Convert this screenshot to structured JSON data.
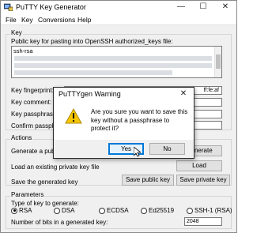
{
  "window": {
    "title": "PuTTY Key Generator",
    "controls": {
      "minimize": "—",
      "maximize": "☐",
      "close": "✕"
    }
  },
  "menu": [
    "File",
    "Key",
    "Conversions",
    "Help"
  ],
  "key_group": {
    "label": "Key",
    "public_key_label": "Public key for pasting into OpenSSH authorized_keys file:",
    "public_key_first_line": "ssh-rsa",
    "fingerprint_label": "Key fingerprint:",
    "fingerprint_value": "ff:fe:af",
    "comment_label": "Key comment:",
    "passphrase_label": "Key passphrase:",
    "confirm_label": "Confirm passphrase:"
  },
  "actions_group": {
    "label": "Actions",
    "generate_label": "Generate a public/private key pair",
    "generate_button": "Generate",
    "load_label": "Load an existing private key file",
    "load_button": "Load",
    "save_label": "Save the generated key",
    "save_public_button": "Save public key",
    "save_private_button": "Save private key"
  },
  "parameters_group": {
    "label": "Parameters",
    "type_label": "Type of key to generate:",
    "key_types": [
      "RSA",
      "DSA",
      "ECDSA",
      "Ed25519",
      "SSH-1 (RSA)"
    ],
    "selected_type": "RSA",
    "bits_label": "Number of bits in a generated key:",
    "bits_value": "2048"
  },
  "dialog": {
    "title": "PuTTYgen Warning",
    "close": "✕",
    "message": "Are you sure you want to save this key without a passphrase to protect it?",
    "yes_button": "Yes",
    "no_button": "No",
    "icon": "warning-icon"
  }
}
